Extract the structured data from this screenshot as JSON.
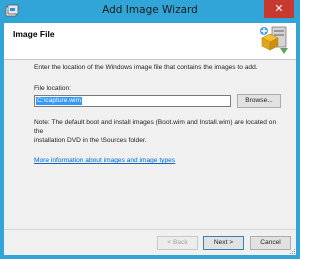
{
  "window": {
    "title": "Add Image Wizard",
    "close_glyph": "✕",
    "app_icon": "wizard-app-icon"
  },
  "header": {
    "title": "Image File",
    "icon": "image-file-wizard-icon"
  },
  "body": {
    "instruction": "Enter the location of the Windows image file that contains the images to add.",
    "file_location_label": "File location:",
    "file_location_value": "C:\\capture.wim",
    "browse_label": "Browse...",
    "note_line1": "Note: The default boot and install images (Boot.wim and Install.wim) are located on the",
    "note_line2": "installation DVD in the \\Sources folder.",
    "help_link": "More information about images and image types"
  },
  "footer": {
    "back_label": "< Back",
    "next_label": "Next >",
    "cancel_label": "Cancel"
  },
  "colors": {
    "titlebar": "#31a5d8",
    "close_button": "#c7392f",
    "selection": "#3399ff",
    "link": "#0066cc"
  }
}
